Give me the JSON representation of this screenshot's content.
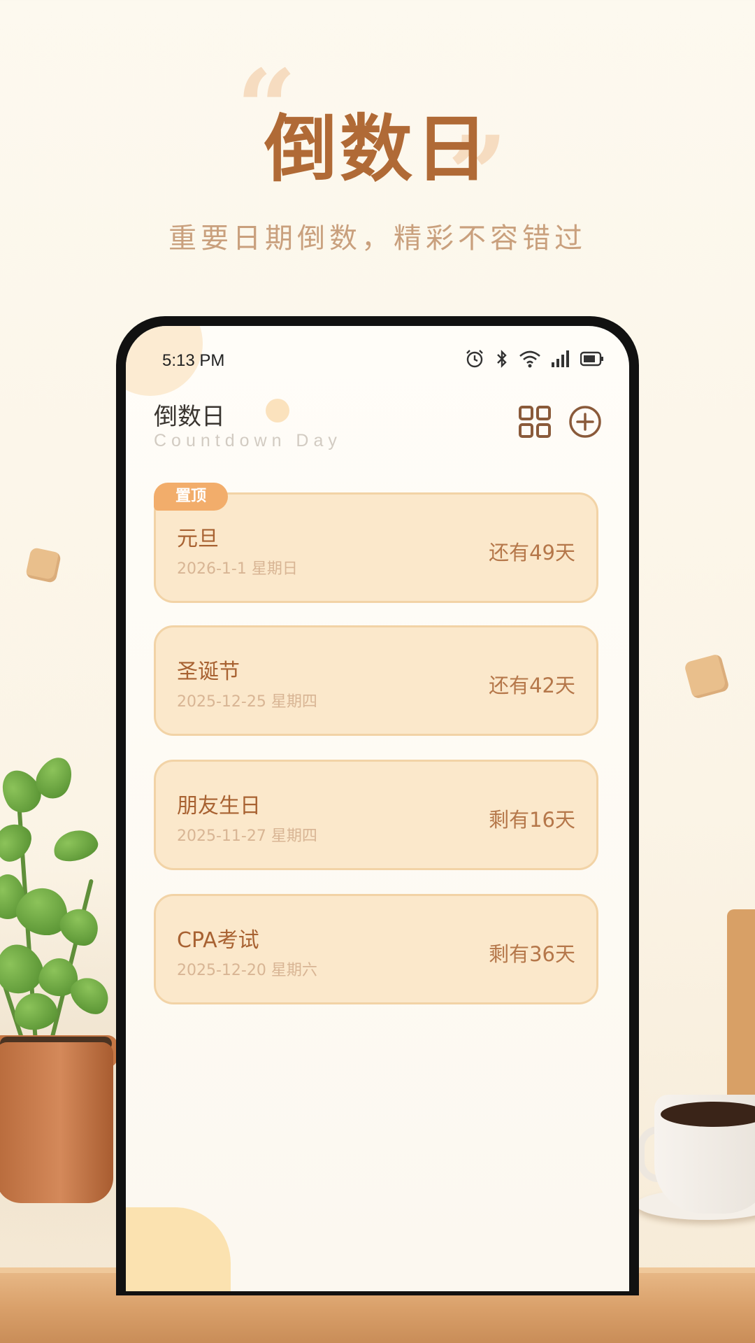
{
  "poster": {
    "title": "倒数日",
    "subtitle": "重要日期倒数，精彩不容错过"
  },
  "status_bar": {
    "time": "5:13 PM",
    "icons": [
      "alarm-icon",
      "bluetooth-icon",
      "wifi-icon",
      "signal-icon",
      "battery-icon"
    ]
  },
  "app_header": {
    "title": "倒数日",
    "subtitle": "Countdown Day",
    "actions": [
      "grid-view-icon",
      "add-circle-icon"
    ]
  },
  "events": [
    {
      "name": "元旦",
      "date": "2026-1-1 星期日",
      "remaining": "还有49天",
      "badge": "置顶"
    },
    {
      "name": "圣诞节",
      "date": "2025-12-25 星期四",
      "remaining": "还有42天"
    },
    {
      "name": "朋友生日",
      "date": "2025-11-27 星期四",
      "remaining": "剩有16天"
    },
    {
      "name": "CPA考试",
      "date": "2025-12-20 星期六",
      "remaining": "剩有36天"
    }
  ],
  "colors": {
    "accent": "#b06a36",
    "card_bg": "#fbe8cb",
    "badge": "#f2ad6b"
  }
}
